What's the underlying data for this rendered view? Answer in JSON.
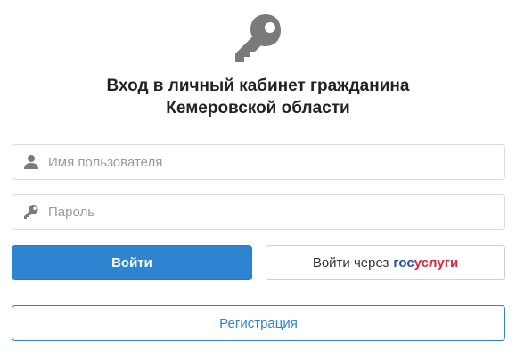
{
  "header": {
    "icon": "key-icon",
    "title_line1": "Вход в личный кабинет гражданина",
    "title_line2": "Кемеровской области"
  },
  "form": {
    "username": {
      "icon": "user-icon",
      "placeholder": "Имя пользователя",
      "value": ""
    },
    "password": {
      "icon": "key-small-icon",
      "placeholder": "Пароль",
      "value": ""
    }
  },
  "buttons": {
    "login_label": "Войти",
    "gosuslugi_prefix": "Войти через",
    "gosuslugi_brand_part1": "гос",
    "gosuslugi_brand_part2": "услуги",
    "register_label": "Регистрация"
  },
  "colors": {
    "primary": "#2d84d1",
    "icon_gray": "#7a7a7a",
    "gos_blue": "#1e4fa0",
    "gos_red": "#d3283e"
  }
}
